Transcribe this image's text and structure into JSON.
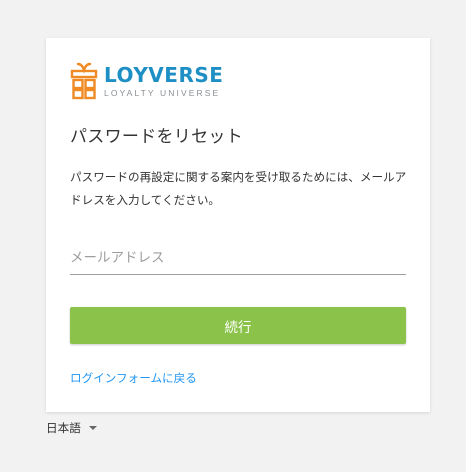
{
  "brand": {
    "name": "LOYVERSE",
    "tagline": "LOYALTY UNIVERSE",
    "logo_icon": "gift-box-icon",
    "primary_color": "#1e8fc5",
    "icon_color": "#f08a24"
  },
  "form": {
    "title": "パスワードをリセット",
    "description": "パスワードの再設定に関する案内を受け取るためには、メールアドレスを入力してください。",
    "email_placeholder": "メールアドレス",
    "email_value": "",
    "submit_label": "続行",
    "submit_color": "#8bc34a",
    "back_link_label": "ログインフォームに戻る",
    "link_color": "#2196f3"
  },
  "language": {
    "selected": "日本語",
    "icon": "caret-down-icon"
  }
}
